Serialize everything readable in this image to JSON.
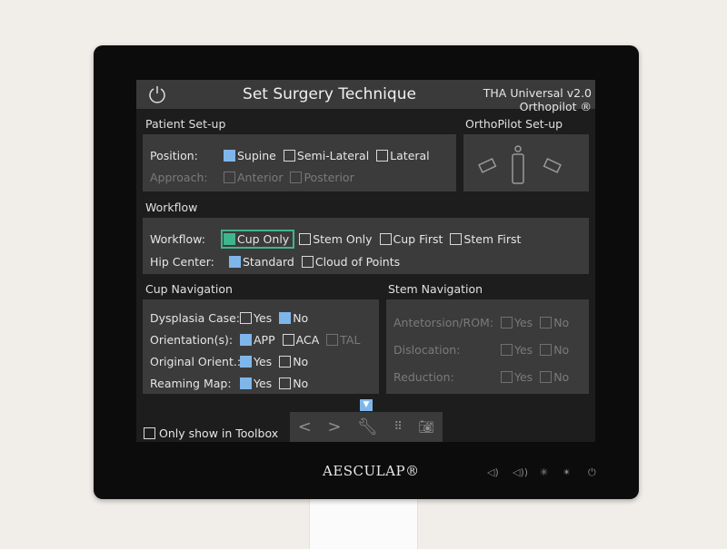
{
  "header": {
    "title": "Set Surgery Technique",
    "product": "THA Universal v2.0",
    "brand_line": "Orthopilot ®",
    "power_icon": "power-icon"
  },
  "patient_setup": {
    "label": "Patient Set-up",
    "position_label": "Position:",
    "positions": [
      {
        "label": "Supine",
        "checked": true
      },
      {
        "label": "Semi-Lateral",
        "checked": false
      },
      {
        "label": "Lateral",
        "checked": false
      }
    ],
    "approach_label": "Approach:",
    "approaches": [
      {
        "label": "Anterior",
        "checked": false
      },
      {
        "label": "Posterior",
        "checked": false
      }
    ]
  },
  "orthopilot_setup": {
    "label": "OrthoPilot Set-up"
  },
  "workflow": {
    "label": "Workflow",
    "workflow_label": "Workflow:",
    "options": [
      {
        "label": "Cup Only",
        "checked": true
      },
      {
        "label": "Stem Only",
        "checked": false
      },
      {
        "label": "Cup First",
        "checked": false
      },
      {
        "label": "Stem First",
        "checked": false
      }
    ],
    "hip_center_label": "Hip Center:",
    "hip_center": [
      {
        "label": "Standard",
        "checked": true
      },
      {
        "label": "Cloud of Points",
        "checked": false
      }
    ]
  },
  "cup_nav": {
    "label": "Cup Navigation",
    "rows": [
      {
        "label": "Dysplasia Case:",
        "options": [
          {
            "label": "Yes",
            "checked": false
          },
          {
            "label": "No",
            "checked": true
          }
        ]
      },
      {
        "label": "Orientation(s):",
        "options": [
          {
            "label": "APP",
            "checked": true
          },
          {
            "label": "ACA",
            "checked": false
          },
          {
            "label": "TAL",
            "checked": false
          }
        ]
      },
      {
        "label": "Original Orient.:",
        "options": [
          {
            "label": "Yes",
            "checked": true
          },
          {
            "label": "No",
            "checked": false
          }
        ]
      },
      {
        "label": "Reaming Map:",
        "options": [
          {
            "label": "Yes",
            "checked": true
          },
          {
            "label": "No",
            "checked": false
          }
        ]
      }
    ]
  },
  "stem_nav": {
    "label": "Stem Navigation",
    "rows": [
      {
        "label": "Antetorsion/ROM:",
        "options": [
          {
            "label": "Yes"
          },
          {
            "label": "No"
          }
        ]
      },
      {
        "label": "Dislocation:",
        "options": [
          {
            "label": "Yes"
          },
          {
            "label": "No"
          }
        ]
      },
      {
        "label": "Reduction:",
        "options": [
          {
            "label": "Yes"
          },
          {
            "label": "No"
          }
        ]
      }
    ]
  },
  "footer": {
    "toolbox_label": "Only show in Toolbox",
    "toolbox_checked": false
  },
  "hardware": {
    "brand": "AESCULAP®"
  },
  "colors": {
    "accent": "#7fb6ea",
    "focus": "#3fb58c",
    "panel": "#3b3b3c"
  }
}
